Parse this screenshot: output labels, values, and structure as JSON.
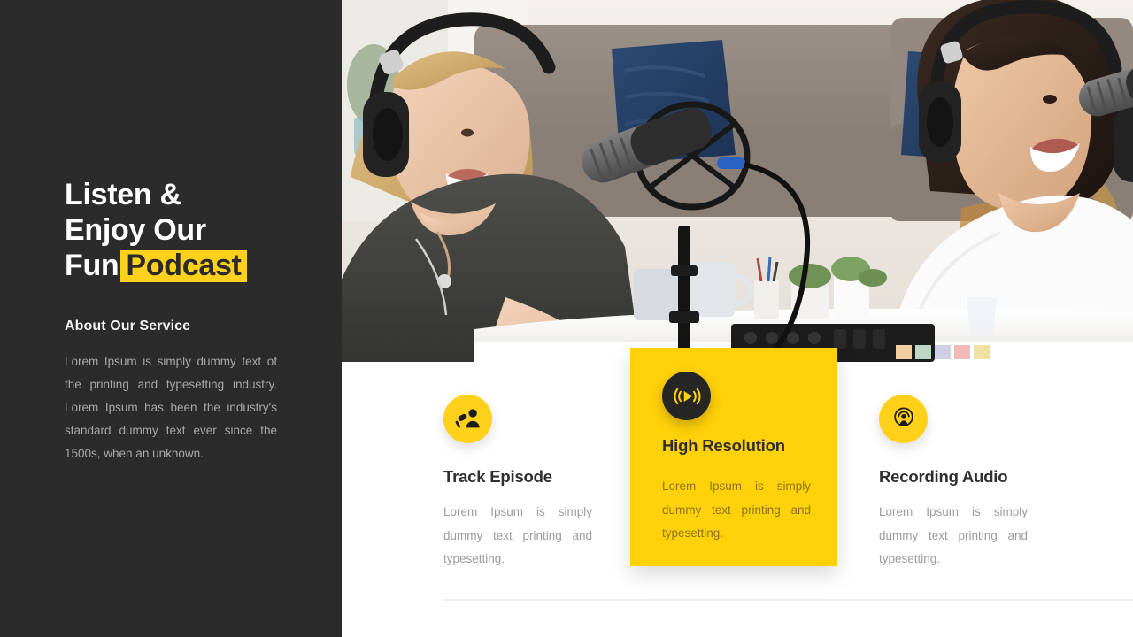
{
  "theme": {
    "sidebar_bg": "#2b2b2b",
    "accent_yellow": "#ffd11a",
    "featured_yellow": "#ffd108",
    "dark_icon_bg": "#262626",
    "body_text": "#a8a8a8",
    "card_text": "#9b9b9b",
    "divider": "#eeeeee"
  },
  "sidebar": {
    "headline_line1": "Listen &",
    "headline_line2": "Enjoy Our",
    "headline_line3_plain": "Fun",
    "headline_line3_highlight": "Podcast",
    "subheading": "About Our Service",
    "paragraph": "Lorem Ipsum is simply dummy text of the printing and typesetting industry.  Lorem Ipsum has been the industry's standard dummy text ever since the 1500s,  when an unknown."
  },
  "hero": {
    "alt": "Three podcast hosts wearing headphones recording at a table with microphones",
    "icon": "podcast-studio-photo"
  },
  "cards": [
    {
      "icon": "microphone-speaker-icon",
      "title": "Track Episode",
      "text": "Lorem Ipsum is simply dummy text printing and typesetting."
    },
    {
      "icon": "play-soundwave-icon",
      "title": "High Resolution",
      "text": "Lorem Ipsum is simply dummy text printing and typesetting.",
      "featured": "true"
    },
    {
      "icon": "podcast-broadcast-icon",
      "title": "Recording Audio",
      "text": "Lorem Ipsum is simply dummy text printing and typesetting."
    }
  ]
}
